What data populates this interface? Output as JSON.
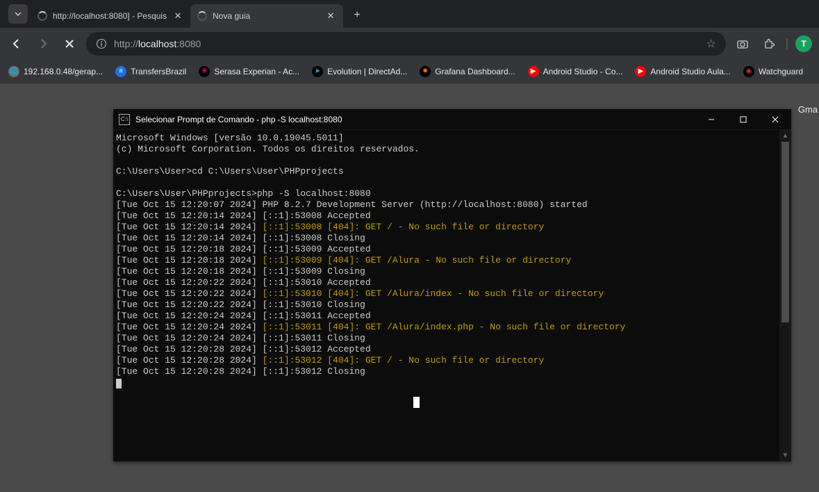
{
  "browser": {
    "tabs": [
      {
        "title": "http://localhost:8080] - Pesquis",
        "active": false
      },
      {
        "title": "Nova guia",
        "active": true
      }
    ],
    "url_prefix": "http://",
    "url_host": "localhost",
    "url_port": ":8080",
    "bookmarks": [
      {
        "label": "192.168.0.48/gerap...",
        "icon_bg": "#6e6e6e",
        "icon_fg": "#ffffff",
        "glyph": "🌐"
      },
      {
        "label": "TransfersBrazil",
        "icon_bg": "#1a73e8",
        "icon_fg": "#ffffff",
        "glyph": "≡"
      },
      {
        "label": "Serasa Experian - Ac...",
        "icon_bg": "#000000",
        "icon_fg": "#e6007e",
        "glyph": "❋"
      },
      {
        "label": "Evolution | DirectAd...",
        "icon_bg": "#000000",
        "icon_fg": "#2aa3ef",
        "glyph": "➤"
      },
      {
        "label": "Grafana Dashboard...",
        "icon_bg": "#000000",
        "icon_fg": "#f46800",
        "glyph": "✹"
      },
      {
        "label": "Android Studio - Co...",
        "icon_bg": "#ff0000",
        "icon_fg": "#ffffff",
        "glyph": "▶"
      },
      {
        "label": "Android Studio Aula...",
        "icon_bg": "#ff0000",
        "icon_fg": "#ffffff",
        "glyph": "▶"
      },
      {
        "label": "Watchguard",
        "icon_bg": "#000000",
        "icon_fg": "#d9232e",
        "glyph": "◉"
      }
    ],
    "gmail": "Gma"
  },
  "terminal": {
    "title": "Selecionar Prompt de Comando - php  -S localhost:8080",
    "lines": [
      {
        "t": "Microsoft Windows [versão 10.0.19045.5011]"
      },
      {
        "t": "(c) Microsoft Corporation. Todos os direitos reservados."
      },
      {
        "t": ""
      },
      {
        "t": "C:\\Users\\User>cd C:\\Users\\User\\PHPprojects"
      },
      {
        "t": ""
      },
      {
        "t": "C:\\Users\\User\\PHPprojects>php -S localhost:8080"
      },
      {
        "t": "[Tue Oct 15 12:20:07 2024] PHP 8.2.7 Development Server (http://localhost:8080) started"
      },
      {
        "t": "[Tue Oct 15 12:20:14 2024] [::1]:53008 Accepted"
      },
      {
        "prefix": "[Tue Oct 15 12:20:14 2024] ",
        "warn": "[::1]:53008 [404]: GET / - No such file or directory"
      },
      {
        "t": "[Tue Oct 15 12:20:14 2024] [::1]:53008 Closing"
      },
      {
        "t": "[Tue Oct 15 12:20:18 2024] [::1]:53009 Accepted"
      },
      {
        "prefix": "[Tue Oct 15 12:20:18 2024] ",
        "warn": "[::1]:53009 [404]: GET /Alura - No such file or directory"
      },
      {
        "t": "[Tue Oct 15 12:20:18 2024] [::1]:53009 Closing"
      },
      {
        "t": "[Tue Oct 15 12:20:22 2024] [::1]:53010 Accepted"
      },
      {
        "prefix": "[Tue Oct 15 12:20:22 2024] ",
        "warn": "[::1]:53010 [404]: GET /Alura/index - No such file or directory"
      },
      {
        "t": "[Tue Oct 15 12:20:22 2024] [::1]:53010 Closing"
      },
      {
        "t": "[Tue Oct 15 12:20:24 2024] [::1]:53011 Accepted"
      },
      {
        "prefix": "[Tue Oct 15 12:20:24 2024] ",
        "warn": "[::1]:53011 [404]: GET /Alura/index.php - No such file or directory"
      },
      {
        "t": "[Tue Oct 15 12:20:24 2024] [::1]:53011 Closing"
      },
      {
        "t": "[Tue Oct 15 12:20:28 2024] [::1]:53012 Accepted"
      },
      {
        "prefix": "[Tue Oct 15 12:20:28 2024] ",
        "warn": "[::1]:53012 [404]: GET / - No such file or directory"
      },
      {
        "t": "[Tue Oct 15 12:20:28 2024] [::1]:53012 Closing"
      }
    ]
  }
}
